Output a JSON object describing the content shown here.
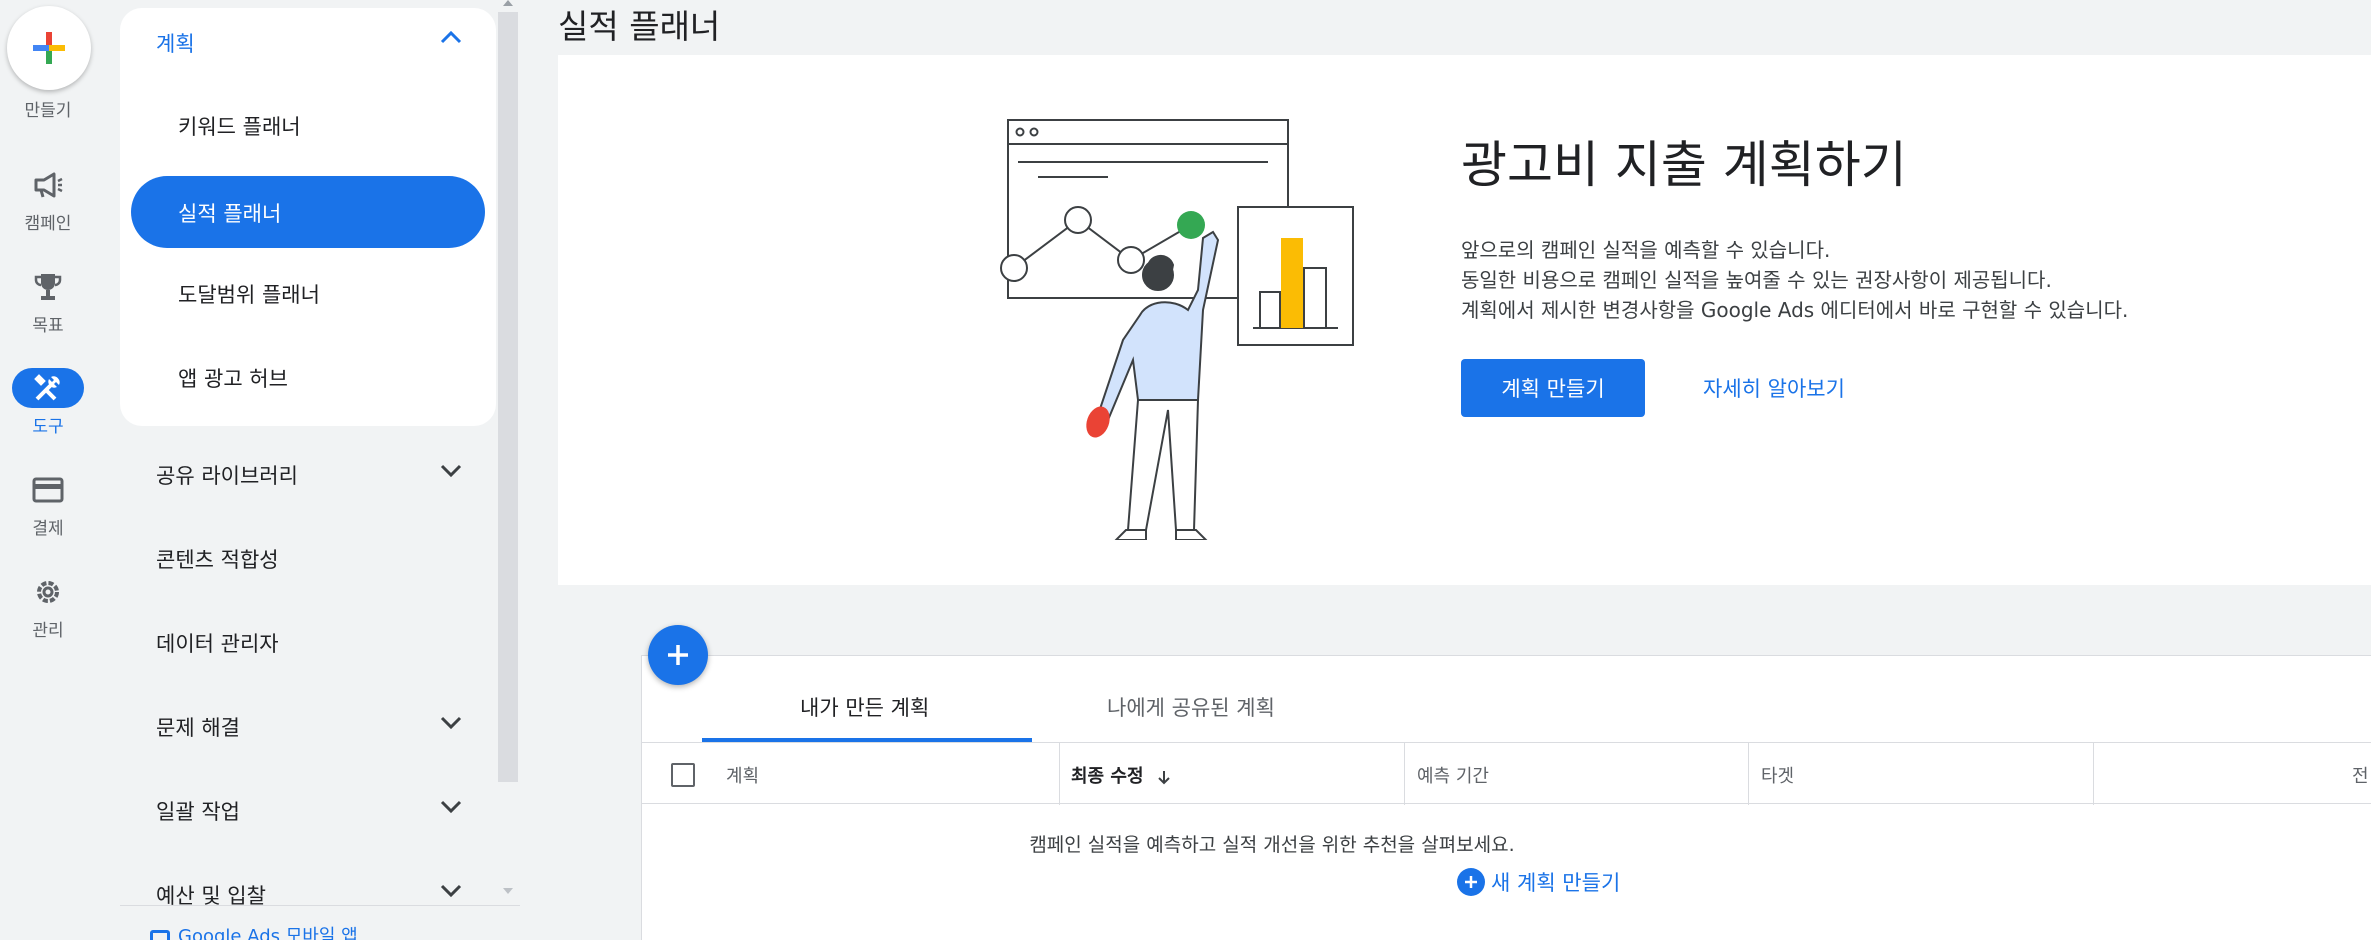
{
  "rail": {
    "create_label": "만들기",
    "items": [
      {
        "label": "캠페인",
        "icon": "campaign-megaphone-icon"
      },
      {
        "label": "목표",
        "icon": "trophy-icon"
      },
      {
        "label": "도구",
        "icon": "tools-icon"
      },
      {
        "label": "결제",
        "icon": "credit-card-icon"
      },
      {
        "label": "관리",
        "icon": "gear-icon"
      }
    ],
    "active": "도구"
  },
  "sidebar": {
    "section_title": "계획",
    "sub_items": [
      "키워드 플래너",
      "실적 플래너",
      "도달범위 플래너",
      "앱 광고 허브"
    ],
    "active_sub": "실적 플래너",
    "items": [
      "공유 라이브러리",
      "콘텐츠 적합성",
      "데이터 관리자",
      "문제 해결",
      "일괄 작업",
      "예산 및 입찰"
    ],
    "mobile_app_link": "Google Ads 모바일 앱"
  },
  "page": {
    "title": "실적 플래너"
  },
  "hero": {
    "title": "광고비 지출 계획하기",
    "lines": [
      "앞으로의 캠페인 실적을 예측할 수 있습니다.",
      "동일한 비용으로 캠페인 실적을 높여줄 수 있는 권장사항이 제공됩니다.",
      "계획에서 제시한 변경사항을 Google Ads 에디터에서 바로 구현할 수 있습니다."
    ],
    "primary_button": "계획 만들기",
    "link": "자세히 알아보기"
  },
  "plans": {
    "tabs": [
      "내가 만든 계획",
      "나에게 공유된 계획"
    ],
    "active_tab": "내가 만든 계획",
    "columns": [
      "계획",
      "최종 수정",
      "예측 기간",
      "타겟",
      "전"
    ],
    "sorted_column": "최종 수정",
    "empty_message": "캠페인 실적을 예측하고 실적 개선을 위한 추천을 살펴보세요.",
    "new_plan_link": "새 계획 만들기"
  },
  "colors": {
    "accent": "#1a73e8",
    "background": "#f1f3f4",
    "bar": "#fbbc04",
    "dot_green": "#34a853",
    "dot_red": "#ea4335"
  }
}
